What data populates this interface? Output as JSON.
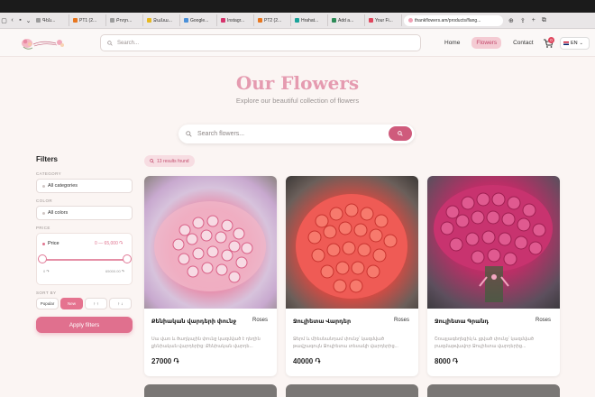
{
  "browser": {
    "tabs": [
      {
        "label": "Գեն...",
        "color": "#9c9c9c"
      },
      {
        "label": "PT1 (2...",
        "color": "#e8761e"
      },
      {
        "label": "Բողո...",
        "color": "#9c9c9c"
      },
      {
        "label": "Ձանա...",
        "color": "#e7b81f"
      },
      {
        "label": "Google...",
        "color": "#4a90d9"
      },
      {
        "label": "Instagr...",
        "color": "#d6336c"
      },
      {
        "label": "PT2 (2...",
        "color": "#e8761e"
      },
      {
        "label": "Hrahat...",
        "color": "#1aa39a"
      },
      {
        "label": "Add a...",
        "color": "#2e8b57"
      },
      {
        "label": "Your Fi...",
        "color": "#e0455c"
      }
    ],
    "url": "thankflowers.am/products/flang..."
  },
  "header": {
    "search_placeholder": "Search...",
    "nav": [
      "Home",
      "Flowers",
      "Contact"
    ],
    "cart_count": "0",
    "language": "EN"
  },
  "hero": {
    "title": "Our Flowers",
    "subtitle": "Explore our beautiful collection of flowers",
    "search_placeholder": "Search flowers..."
  },
  "filters": {
    "title": "Filters",
    "category_label": "CATEGORY",
    "category_value": "All categories",
    "color_label": "COLOR",
    "color_value": "All colors",
    "price_label": "PRICE",
    "price_title": "Price",
    "price_range": "0 — 65,000 ֏",
    "price_min": "0 ֏",
    "price_max": "65000.00 ֏",
    "sort_label": "SORT BY",
    "sort_options": [
      "Popular",
      "New",
      "↑ ↑",
      "↑ ↓"
    ],
    "apply_label": "Apply filters"
  },
  "results": {
    "text": "13 results found"
  },
  "products": [
    {
      "name": "Քենիական վարդերի փունջ",
      "category": "Roses",
      "description": "Սա վառ և ծաղկային փունջ կազմված է դեղին քենիական վարդերից: Քենիական վարդե...",
      "price": "27000 ֏"
    },
    {
      "name": "Ջուլիետա Վարդեր",
      "category": "Roses",
      "description": "Ջերմ և միեսնանդամ փունջ՝ կազմված թավշագույն Ջուլիետա տեսակի վարդերից...",
      "price": "40000 ֏"
    },
    {
      "name": "Ջուլիետա Գրանդ",
      "category": "Roses",
      "description": "Շռայլագեղեցիկ և լցված փունջ՝ կազմված բազմաթվավոր Ջուլիետա վարդերից...",
      "price": "8000 ֏"
    }
  ],
  "colors": {
    "accent": "#e0708e",
    "nav_active_bg": "#f4cbd3",
    "title_pink": "#e59bb0"
  }
}
